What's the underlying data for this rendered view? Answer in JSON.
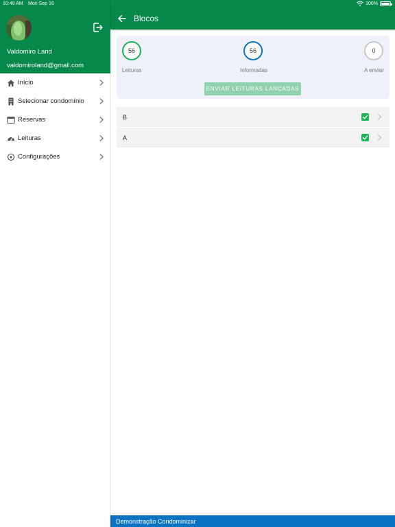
{
  "status_bar": {
    "time": "10:40 AM",
    "date": "Mon Sep 16",
    "battery": "100%"
  },
  "profile": {
    "name": "Valdomiro Land",
    "email": "valdomiroland@gmail.com"
  },
  "menu": {
    "items": [
      {
        "label": "Início",
        "icon": "home-icon"
      },
      {
        "label": "Selecionar condomínio",
        "icon": "building-icon"
      },
      {
        "label": "Reservas",
        "icon": "calendar-icon"
      },
      {
        "label": "Leituras",
        "icon": "gauge-icon"
      },
      {
        "label": "Configurações",
        "icon": "gear-icon"
      }
    ]
  },
  "header": {
    "title": "Blocos"
  },
  "summary": {
    "leituras": {
      "value": "56",
      "label": "Leituras",
      "color": "#1bb35a"
    },
    "informadas": {
      "value": "56",
      "label": "Informadas",
      "color": "#0a73c2"
    },
    "a_enviar": {
      "value": "0",
      "label": "A enviar",
      "color": "#c8c8c8"
    },
    "send_button_label": "ENVIAR LEITURAS LANÇADAS"
  },
  "blocks": [
    {
      "label": "B",
      "checked": true
    },
    {
      "label": "A",
      "checked": true
    }
  ],
  "footer": {
    "text": "Demonstração Condominizar"
  },
  "colors": {
    "primary": "#05884a",
    "footer": "#0a73c2",
    "check": "#1bb35a",
    "button_disabled": "#8fd2ad"
  }
}
